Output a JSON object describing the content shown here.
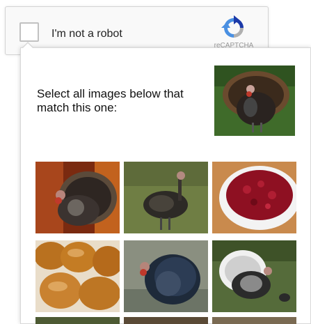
{
  "anchor": {
    "checkbox_label": "I'm not a robot",
    "logo_text": "reCAPTCHA",
    "logo_icon": "recaptcha-logo-icon"
  },
  "challenge": {
    "prompt": "Select all images below that match this one:",
    "sample_image": "turkey",
    "tiles": [
      {
        "subject": "turkey"
      },
      {
        "subject": "turkey"
      },
      {
        "subject": "cranberry-sauce"
      },
      {
        "subject": "bread-rolls"
      },
      {
        "subject": "turkey"
      },
      {
        "subject": "turkey"
      },
      {
        "subject": "partial"
      },
      {
        "subject": "partial"
      },
      {
        "subject": "partial"
      }
    ]
  },
  "colors": {
    "logo_blue": "#4a90e2",
    "logo_dark_blue": "#1c3aa9",
    "logo_grey": "#b0b0b0"
  }
}
